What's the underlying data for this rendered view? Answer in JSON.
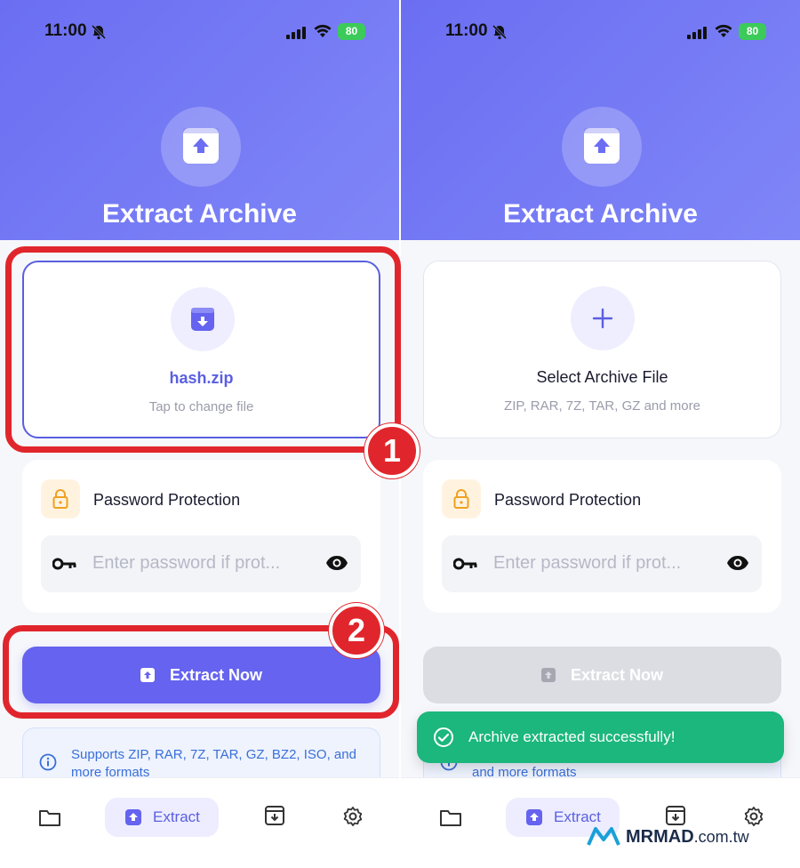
{
  "status_bar": {
    "time": "11:00",
    "battery": "80"
  },
  "header": {
    "title": "Extract Archive"
  },
  "left_screen": {
    "file_card": {
      "name": "hash.zip",
      "subtitle": "Tap to change file"
    },
    "password": {
      "title": "Password Protection",
      "placeholder": "Enter password if prot..."
    },
    "extract_button": {
      "label": "Extract Now",
      "state": "enabled"
    },
    "info": {
      "text": "Supports ZIP, RAR, 7Z, TAR, GZ, BZ2, ISO, and more formats"
    }
  },
  "right_screen": {
    "file_card": {
      "name": "Select Archive File",
      "subtitle": "ZIP, RAR, 7Z, TAR, GZ and more"
    },
    "password": {
      "title": "Password Protection",
      "placeholder": "Enter password if prot..."
    },
    "extract_button": {
      "label": "Extract Now",
      "state": "disabled"
    },
    "info": {
      "text": "and more formats"
    },
    "toast": {
      "text": "Archive extracted successfully!"
    }
  },
  "tabbar": {
    "files_icon": "folder-icon",
    "extract_label": "Extract",
    "archive_icon": "archive-icon",
    "settings_icon": "gear-icon"
  },
  "annotations": {
    "step1": "1",
    "step2": "2"
  },
  "watermark": {
    "brand": "MRMAD",
    "domain": ".com.tw"
  },
  "colors": {
    "primary": "#6563ef",
    "success": "#1bb77c",
    "highlight": "#e0262c",
    "disabled": "#dcdde3"
  }
}
